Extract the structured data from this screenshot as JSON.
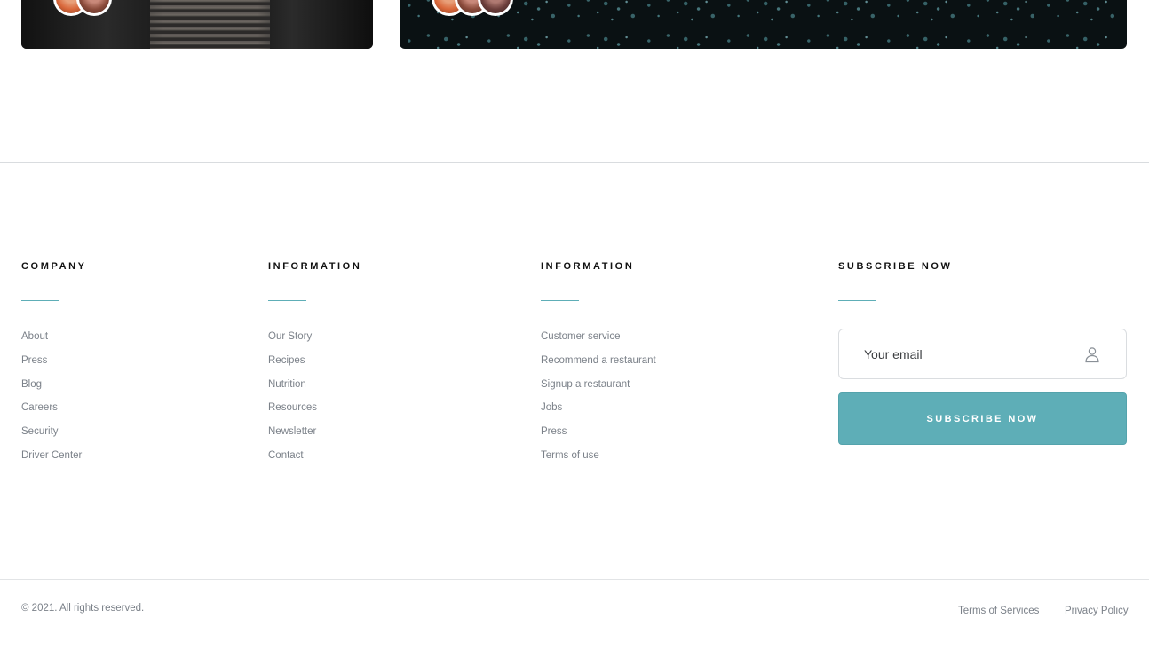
{
  "cards": {
    "left": {
      "image": "stairs-photo",
      "avatar_colors": [
        "#d9673a",
        "#8a4a3a"
      ]
    },
    "right": {
      "image": "bokeh-photo",
      "avatar_colors": [
        "#d9673a",
        "#8a4a3a",
        "#6b3d3a"
      ]
    }
  },
  "footer": {
    "columns": [
      {
        "title": "COMPANY",
        "items": [
          "About",
          "Press",
          "Blog",
          "Careers",
          "Security",
          "Driver Center"
        ]
      },
      {
        "title": "INFORMATION",
        "items": [
          "Our Story",
          "Recipes",
          "Nutrition",
          "Resources",
          "Newsletter",
          "Contact"
        ]
      },
      {
        "title": "INFORMATION",
        "items": [
          "Customer service",
          "Recommend a restaurant",
          "Signup a restaurant",
          "Jobs",
          "Press",
          "Terms of use"
        ]
      }
    ],
    "subscribe": {
      "title": "SUBSCRIBE NOW",
      "email_placeholder": "Your email",
      "email_icon": "user-icon",
      "button_label": "SUBSCRIBE NOW"
    },
    "copyright": "© 2021. All rights reserved.",
    "legal_links": [
      "Terms of Services",
      "Privacy Policy"
    ]
  },
  "colors": {
    "accent": "#5eaeb7",
    "heading": "#111111",
    "link": "#7b8189"
  }
}
